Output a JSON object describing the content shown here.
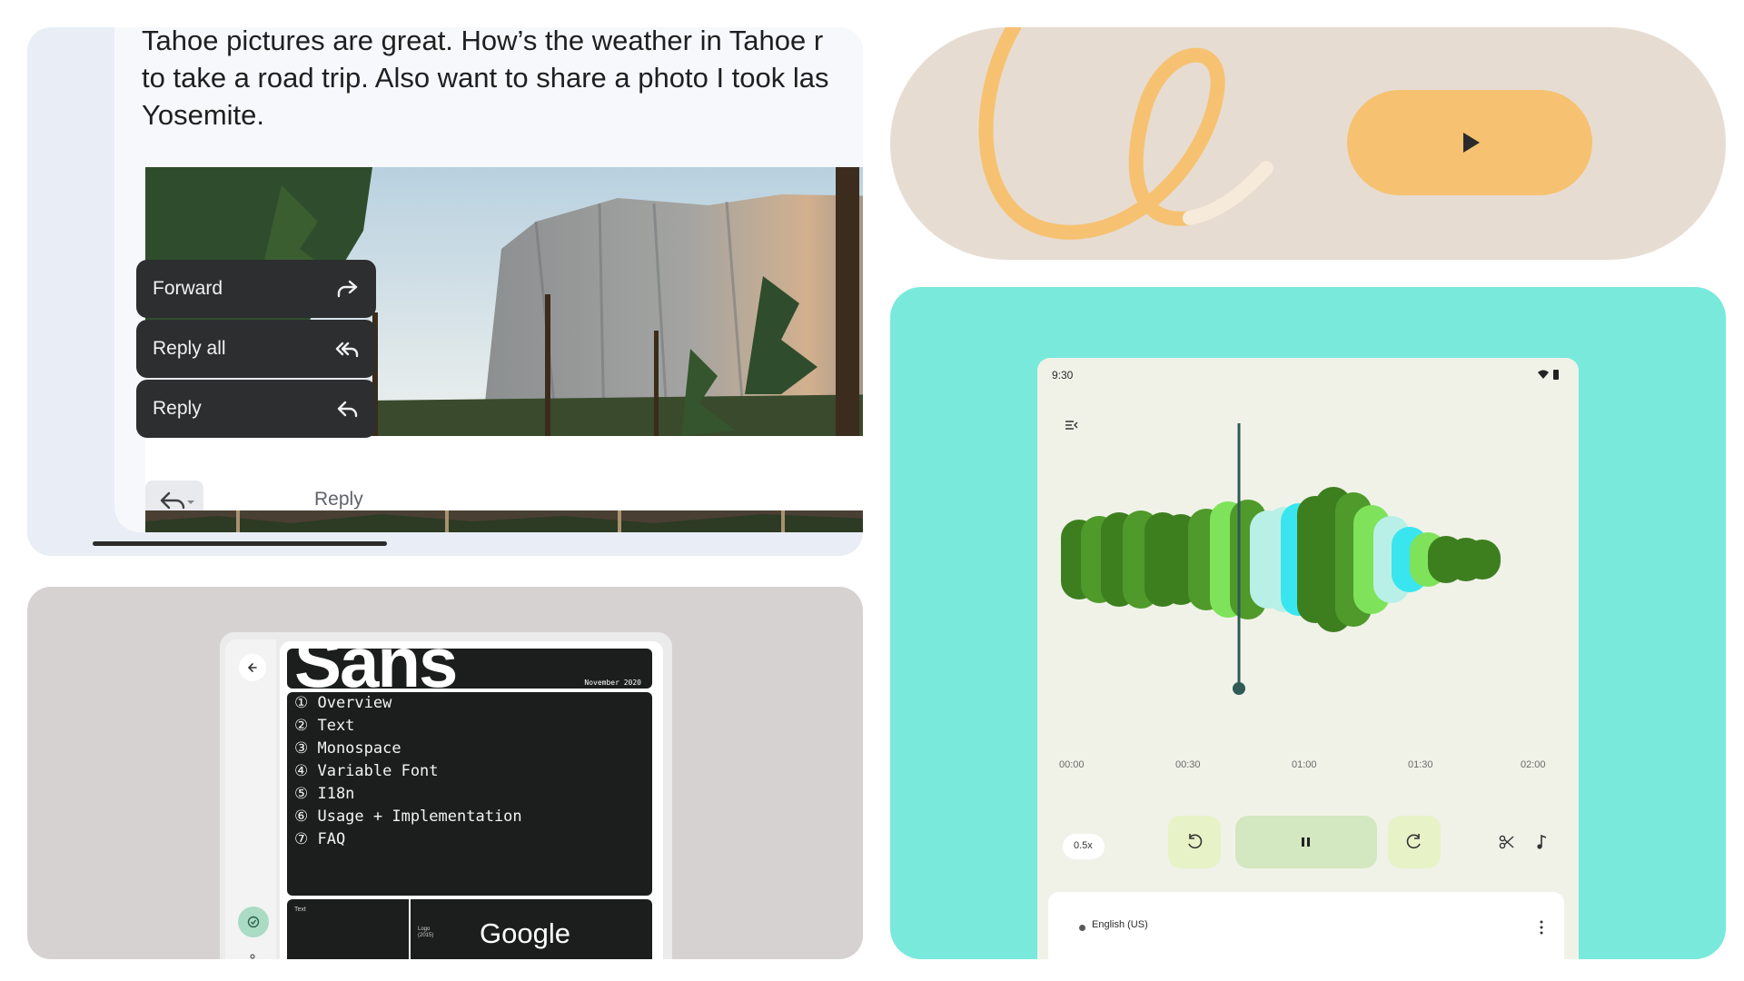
{
  "email_card": {
    "body_lines": [
      "Tahoe pictures are great. How’s the weather in Tahoe r",
      "to take a road trip. Also want to share a photo I took las",
      "Yosemite."
    ],
    "menu": [
      {
        "label": "Forward",
        "icon": "forward-icon"
      },
      {
        "label": "Reply all",
        "icon": "reply-all-icon"
      },
      {
        "label": "Reply",
        "icon": "reply-icon"
      }
    ],
    "reply_placeholder": "Reply"
  },
  "player_card": {
    "accent_color": "#f6c271",
    "background_color": "#e6dcd2",
    "play_icon": "play-icon"
  },
  "font_card": {
    "header_word": "Sans",
    "header_date": "November 2020",
    "toc": [
      "① Overview",
      "② Text",
      "③ Monospace",
      "④ Variable Font",
      "⑤ I18n",
      "⑥ Usage + Implementation",
      "⑦ FAQ"
    ],
    "text_tag": "Text",
    "logo_tag_lines": [
      "Logo",
      "(2015)"
    ],
    "logo_word": "Google"
  },
  "recorder_card": {
    "status_time": "9:30",
    "timeline": [
      "00:00",
      "00:30",
      "01:00",
      "01:30",
      "02:00"
    ],
    "playhead_time": "00:49",
    "speed": "0.5x",
    "language": "English (US)",
    "wave_colors": [
      "#3d7f1f",
      "#4f9a2a",
      "#7ee35a",
      "#b8f0e8",
      "#39e6ef"
    ]
  }
}
